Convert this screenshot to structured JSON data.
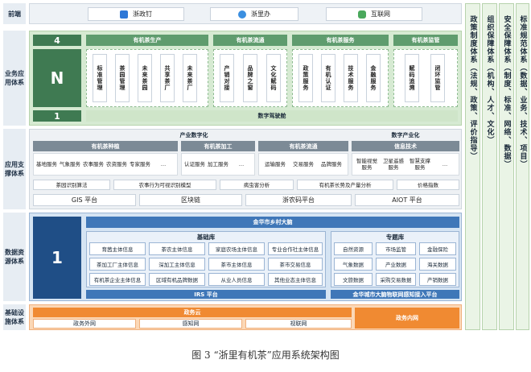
{
  "layers": {
    "front": "前端",
    "app": "业务应用体系",
    "support": "应用支撑体系",
    "data": "数据资源体系",
    "infra": "基础设施体系"
  },
  "front": [
    "浙政钉",
    "浙里办",
    "互联网"
  ],
  "app": {
    "num4": "4",
    "numN": "N",
    "num1": "1",
    "groups": [
      {
        "title": "有机茶生产",
        "items": [
          "标准管理",
          "茶园管理",
          "未来茶园",
          "共享茶厂",
          "未来茶厂"
        ]
      },
      {
        "title": "有机茶流通",
        "items": [
          "产销对接",
          "品牌之窗",
          "文化赋码"
        ]
      },
      {
        "title": "有机茶服务",
        "items": [
          "政策服务",
          "有机认证",
          "技术服务",
          "金融服务"
        ]
      },
      {
        "title": "有机茶监管",
        "items": [
          "赋码追溯",
          "闭环监管"
        ]
      }
    ],
    "cockpit": "数字驾驶舱"
  },
  "support": {
    "ind_digit": "产业数字化",
    "digit_ind": "数字产业化",
    "cols": [
      {
        "title": "有机茶种植",
        "items": [
          "基地服务",
          "气象服务",
          "农事服务",
          "农资服务",
          "专家服务",
          "…"
        ]
      },
      {
        "title": "有机茶加工",
        "items": [
          "认证服务",
          "加工服务",
          "…"
        ]
      },
      {
        "title": "有机茶流通",
        "items": [
          "运输服务",
          "交易服务",
          "品牌服务"
        ]
      },
      {
        "title": "信息技术",
        "items": [
          "智能视觉服务",
          "卫星遥感服务",
          "智慧支撑服务",
          "…"
        ]
      }
    ],
    "algos": [
      "茶园识别算法",
      "农事行为可视识别模型",
      "病虫害分析",
      "有机茶长势及产量分析",
      "价格指数"
    ],
    "platforms": [
      "GIS 平台",
      "区块链",
      "浙农码平台",
      "AIOT 平台"
    ]
  },
  "data": {
    "num1": "1",
    "brain": "金华市乡村大脑",
    "base_title": "基础库",
    "base": [
      [
        "育茜主体信息",
        "茶农主体信息",
        "家庭农场主体信息",
        "专业合作社主体信息"
      ],
      [
        "茶加工厂主体信息",
        "深加工主体信息",
        "茶市主体信息",
        "茶市交易信息"
      ],
      [
        "有机茶企业主体信息",
        "区域有机品牌数据",
        "从业人员信息",
        "其他业态主体信息"
      ]
    ],
    "topic_title": "专题库",
    "topic": [
      [
        "自然资源",
        "市场监管",
        "金融保险"
      ],
      [
        "气象数据",
        "产业数据",
        "海关数据"
      ],
      [
        "文旅数据",
        "采购交易数据",
        "产销数据"
      ]
    ],
    "irs": "IRS 平台",
    "iot": "金华城市大脑物联网感知接入平台"
  },
  "infra": {
    "cloud": "政务云",
    "nets": [
      "政务外网",
      "感知网",
      "视联网"
    ],
    "intranet": "政务内网"
  },
  "side": [
    "政策制度体系（法规、政策、评价指导）",
    "组织保障体系（机构、人才、文化）",
    "安全保障体系（制度、标准、网络、数据）",
    "标准规范体系（数据、业务、技术、项目）"
  ],
  "caption": "图 3 “浙里有机茶”应用系统架构图",
  "colors": {
    "green": "#3f7a52",
    "blue": "#1f4e86",
    "orange": "#f08a32"
  }
}
